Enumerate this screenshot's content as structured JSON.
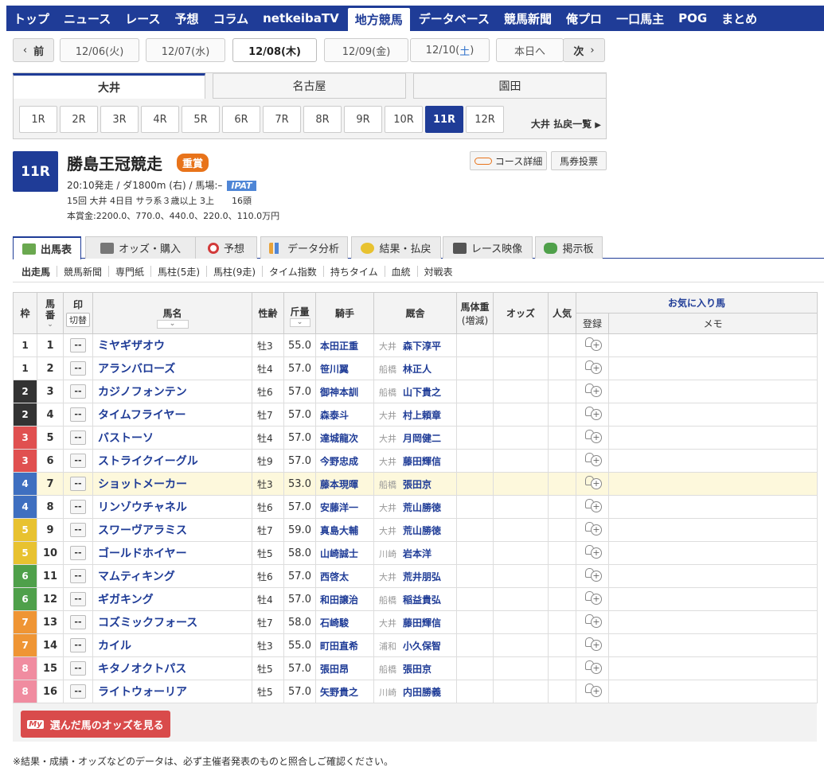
{
  "gnav": [
    "トップ",
    "ニュース",
    "レース",
    "予想",
    "コラム",
    "netkeibaTV",
    "地方競馬",
    "データベース",
    "競馬新聞",
    "俺プロ",
    "一口馬主",
    "POG",
    "まとめ"
  ],
  "gnav_active": "地方競馬",
  "datenav": {
    "prev": "前",
    "dates": [
      "12/06(火)",
      "12/07(水)",
      "12/08(木)",
      "12/09(金)"
    ],
    "sat_prefix": "12/10(",
    "sat_day": "土",
    "sat_suffix": ")",
    "today": "本日へ",
    "next": "次"
  },
  "venues": [
    "大井",
    "名古屋",
    "園田"
  ],
  "races": [
    "1R",
    "2R",
    "3R",
    "4R",
    "5R",
    "6R",
    "7R",
    "8R",
    "9R",
    "10R",
    "11R",
    "12R"
  ],
  "payout_link": "大井 払戻一覧",
  "race": {
    "no": "11R",
    "name": "勝島王冠競走",
    "grade": "重賞",
    "info1": "20:10発走 / ダ1800m (右) / 馬場:–",
    "ipat": "IPAT",
    "info2": "15回 大井 4日目 サラ系３歳以上 3上　　16頭",
    "info3": "本賞金:2200.0、770.0、440.0、220.0、110.0万円",
    "course_btn": "コース詳細",
    "bet_btn": "馬券投票"
  },
  "tabs": [
    "出馬表",
    "オッズ・購入",
    "予想",
    "データ分析",
    "結果・払戻",
    "レース映像",
    "掲示板"
  ],
  "subtabs": [
    "出走馬",
    "競馬新聞",
    "専門紙",
    "馬柱(5走)",
    "馬柱(9走)",
    "タイム指数",
    "持ちタイム",
    "血統",
    "対戦表"
  ],
  "table_headers": {
    "waku": "枠",
    "umaban": "馬番",
    "mark": "印",
    "mark_toggle": "切替",
    "name": "馬名",
    "sex": "性齢",
    "kin": "斤量",
    "jockey": "騎手",
    "trainer": "厩舎",
    "weight_line1": "馬体重",
    "weight_line2": "(増減)",
    "odds": "オッズ",
    "pop": "人気",
    "fav": "お気に入り馬",
    "fav_reg": "登録",
    "memo": "メモ"
  },
  "waku_colors": {
    "1": {
      "bg": "#ffffff",
      "fg": "#333333"
    },
    "2": {
      "bg": "#333333",
      "fg": "#ffffff"
    },
    "3": {
      "bg": "#e05050",
      "fg": "#ffffff"
    },
    "4": {
      "bg": "#3f6fc0",
      "fg": "#ffffff"
    },
    "5": {
      "bg": "#e8c230",
      "fg": "#ffffff"
    },
    "6": {
      "bg": "#4fa04a",
      "fg": "#ffffff"
    },
    "7": {
      "bg": "#ef9534",
      "fg": "#ffffff"
    },
    "8": {
      "bg": "#f08ca0",
      "fg": "#ffffff"
    }
  },
  "mark_text": "--",
  "horses": [
    {
      "waku": "1",
      "umaban": "1",
      "name": "ミヤギザオウ",
      "sex": "牡3",
      "kin": "55.0",
      "jockey": "本田正重",
      "loc": "大井",
      "trainer": "森下淳平"
    },
    {
      "waku": "1",
      "umaban": "2",
      "name": "アランバローズ",
      "sex": "牡4",
      "kin": "57.0",
      "jockey": "笹川翼",
      "loc": "船橋",
      "trainer": "林正人"
    },
    {
      "waku": "2",
      "umaban": "3",
      "name": "カジノフォンテン",
      "sex": "牡6",
      "kin": "57.0",
      "jockey": "御神本訓",
      "loc": "船橋",
      "trainer": "山下貴之"
    },
    {
      "waku": "2",
      "umaban": "4",
      "name": "タイムフライヤー",
      "sex": "牡7",
      "kin": "57.0",
      "jockey": "森泰斗",
      "loc": "大井",
      "trainer": "村上頼章"
    },
    {
      "waku": "3",
      "umaban": "5",
      "name": "バストーソ",
      "sex": "牡4",
      "kin": "57.0",
      "jockey": "達城龍次",
      "loc": "大井",
      "trainer": "月岡健二"
    },
    {
      "waku": "3",
      "umaban": "6",
      "name": "ストライクイーグル",
      "sex": "牡9",
      "kin": "57.0",
      "jockey": "今野忠成",
      "loc": "大井",
      "trainer": "藤田輝信"
    },
    {
      "waku": "4",
      "umaban": "7",
      "name": "ショットメーカー",
      "sex": "牡3",
      "kin": "53.0",
      "jockey": "藤本現暉",
      "loc": "船橋",
      "trainer": "張田京",
      "hl": true
    },
    {
      "waku": "4",
      "umaban": "8",
      "name": "リンゾウチャネル",
      "sex": "牡6",
      "kin": "57.0",
      "jockey": "安藤洋一",
      "loc": "大井",
      "trainer": "荒山勝徳"
    },
    {
      "waku": "5",
      "umaban": "9",
      "name": "スワーヴアラミス",
      "sex": "牡7",
      "kin": "59.0",
      "jockey": "真島大輔",
      "loc": "大井",
      "trainer": "荒山勝徳"
    },
    {
      "waku": "5",
      "umaban": "10",
      "name": "ゴールドホイヤー",
      "sex": "牡5",
      "kin": "58.0",
      "jockey": "山崎誠士",
      "loc": "川崎",
      "trainer": "岩本洋"
    },
    {
      "waku": "6",
      "umaban": "11",
      "name": "マムティキング",
      "sex": "牡6",
      "kin": "57.0",
      "jockey": "西啓太",
      "loc": "大井",
      "trainer": "荒井朋弘"
    },
    {
      "waku": "6",
      "umaban": "12",
      "name": "ギガキング",
      "sex": "牡4",
      "kin": "57.0",
      "jockey": "和田譲治",
      "loc": "船橋",
      "trainer": "稲益貴弘"
    },
    {
      "waku": "7",
      "umaban": "13",
      "name": "コズミックフォース",
      "sex": "牡7",
      "kin": "58.0",
      "jockey": "石崎駿",
      "loc": "大井",
      "trainer": "藤田輝信"
    },
    {
      "waku": "7",
      "umaban": "14",
      "name": "カイル",
      "sex": "牡3",
      "kin": "55.0",
      "jockey": "町田直希",
      "loc": "浦和",
      "trainer": "小久保智"
    },
    {
      "waku": "8",
      "umaban": "15",
      "name": "キタノオクトパス",
      "sex": "牡5",
      "kin": "57.0",
      "jockey": "張田昂",
      "loc": "船橋",
      "trainer": "張田京"
    },
    {
      "waku": "8",
      "umaban": "16",
      "name": "ライトウォーリア",
      "sex": "牡5",
      "kin": "57.0",
      "jockey": "矢野貴之",
      "loc": "川崎",
      "trainer": "内田勝義"
    }
  ],
  "odds_button": {
    "badge": "My",
    "label": "選んだ馬のオッズを見る"
  },
  "disclaimer": "※結果・成績・オッズなどのデータは、必ず主催者発表のものと照合しご確認ください。"
}
